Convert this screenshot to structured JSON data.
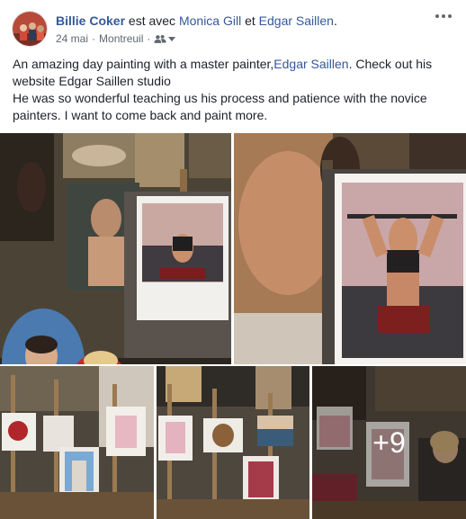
{
  "header": {
    "author": "Billie Coker",
    "connector": "est avec",
    "tagged_1": "Monica Gill",
    "conjunction": "et",
    "tagged_2": "Edgar Saillen",
    "end_punct": ".",
    "date": "24 mai",
    "separator": "·",
    "location": "Montreuil",
    "audience_icon": "friends-icon",
    "more_icon": "more-options-icon"
  },
  "post": {
    "text_part1": "An amazing day painting with a master painter,",
    "text_link": "Edgar Saillen",
    "text_part2": ". Check out his website Edgar Saillen studio",
    "text_line2": "He was so wonderful teaching us his process and patience with the novice painters. I want to come back and paint more."
  },
  "photos": {
    "more_count": "+9"
  },
  "colors": {
    "link": "#365899",
    "text": "#1d2129",
    "meta": "#616770"
  }
}
